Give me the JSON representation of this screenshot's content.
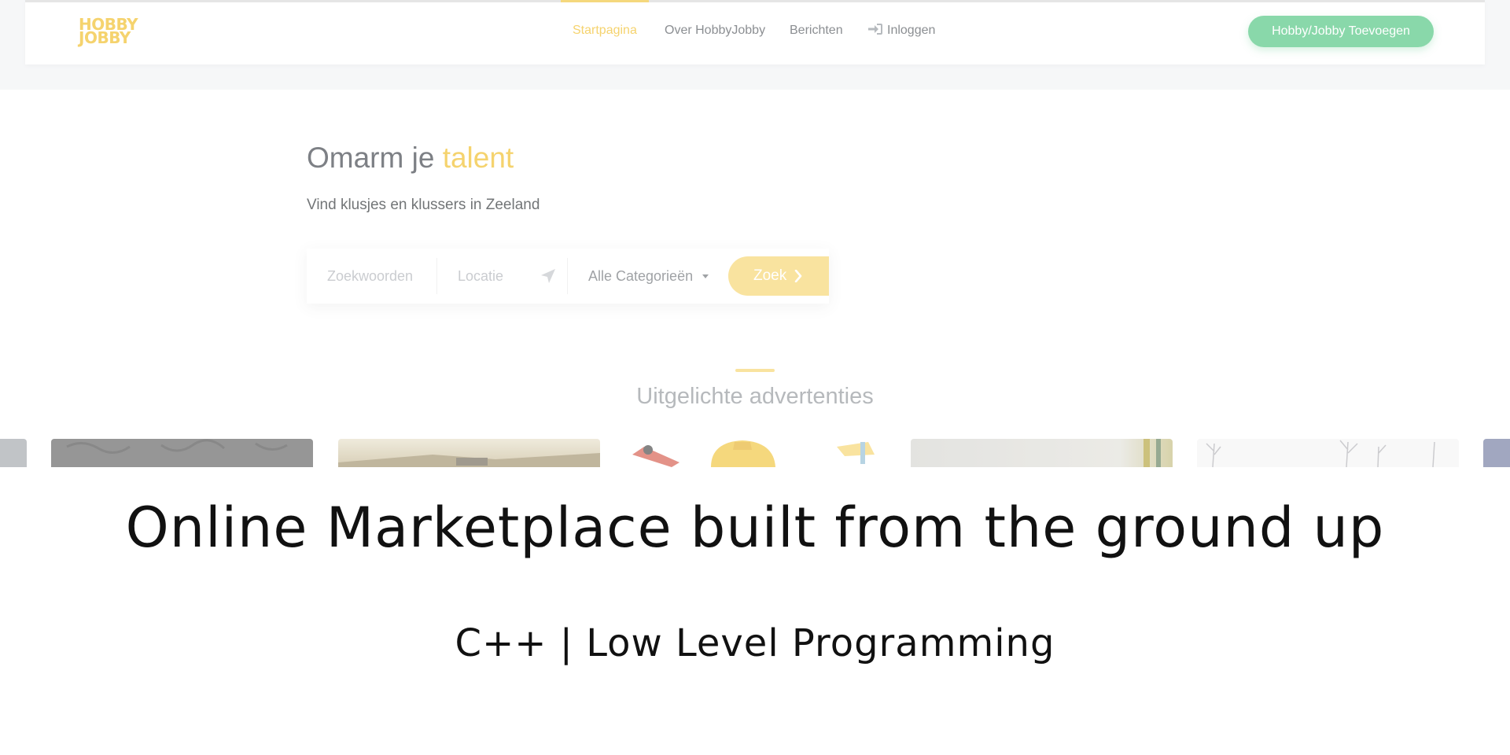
{
  "logo": {
    "line1": "HOBBY",
    "line2": "JOBBY"
  },
  "nav": {
    "home": "Startpagina",
    "about": "Over HobbyJobby",
    "messages": "Berichten",
    "login": "Inloggen",
    "active": "Startpagina",
    "add_button": "Hobby/Jobby Toevoegen"
  },
  "hero": {
    "title_prefix": "Omarm je",
    "title_accent": "talent",
    "subtitle": "Vind klusjes en klussers in Zeeland"
  },
  "search": {
    "keywords_placeholder": "Zoekwoorden",
    "location_placeholder": "Locatie",
    "category_selected": "Alle Categorieën",
    "submit_label": "Zoek"
  },
  "featured": {
    "title": "Uitgelichte advertenties"
  },
  "caption": {
    "title": "Online Marketplace built from the ground up",
    "subtitle": "C++ | Low Level Programming"
  },
  "colors": {
    "accent": "#f2c236",
    "button_green": "#5cc98a",
    "search_button": "#f7d97a",
    "text_dark": "#4b4f56"
  },
  "icons": {
    "login": "sign-in-icon",
    "location": "location-arrow-icon",
    "dropdown": "caret-down-icon",
    "submit": "chevron-right-icon"
  }
}
